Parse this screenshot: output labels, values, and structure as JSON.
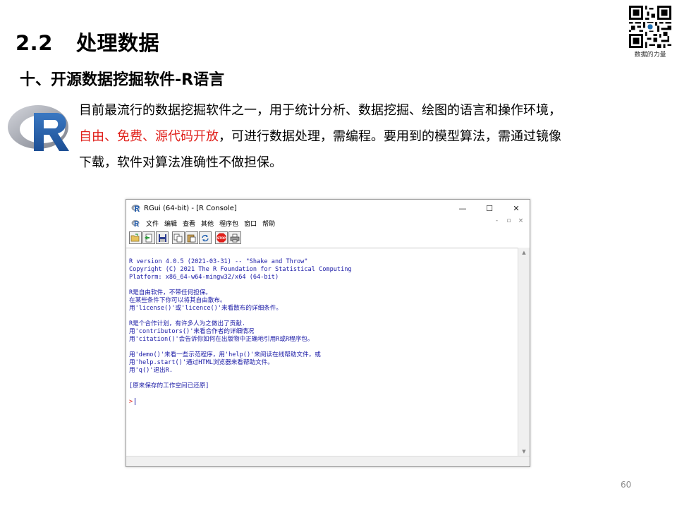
{
  "slide": {
    "section_number": "2.2",
    "section_title": "处理数据",
    "subtitle": "十、开源数据挖掘软件-R语言",
    "qr_caption": "数据的力量",
    "paragraph": {
      "line1": "目前最流行的数据挖掘软件之一，用于统计分析、数据挖掘、绘图的语言和操作环境，",
      "line2_red": "自由、免费、源代码开放",
      "line2_rest": "，可进行数据处理，需编程。要用到的模型算法，需通过镜像",
      "line3": "下载，软件对算法准确性不做担保。"
    },
    "page_number": "60",
    "colors": {
      "red_text": "#e0201b",
      "console_text": "#1a1aa6"
    }
  },
  "window": {
    "title": "RGui (64-bit) - [R Console]",
    "controls": {
      "minimize": "—",
      "maximize": "☐",
      "close": "✕"
    },
    "menu": [
      "文件",
      "编辑",
      "查看",
      "其他",
      "程序包",
      "窗口",
      "帮助"
    ],
    "mdi_controls": {
      "minimize": "-",
      "restore": "▫",
      "close": "×"
    },
    "toolbar_icons": [
      "open-script-icon",
      "load-workspace-icon",
      "save-icon",
      "copy-icon",
      "paste-icon",
      "copy-paste-icon",
      "stop-icon",
      "print-icon"
    ],
    "toolbar_stop_label": "STOP",
    "console_lines": [
      "R version 4.0.5 (2021-03-31) -- \"Shake and Throw\"",
      "Copyright (C) 2021 The R Foundation for Statistical Computing",
      "Platform: x86_64-w64-mingw32/x64 (64-bit)",
      "",
      "R是自由软件，不带任何担保。",
      "在某些条件下你可以将其自由散布。",
      "用'license()'或'licence()'来看散布的详细条件。",
      "",
      "R是个合作计划，有许多人为之做出了贡献.",
      "用'contributors()'来看合作者的详细情况",
      "用'citation()'会告诉你如何在出版物中正确地引用R或R程序包。",
      "",
      "用'demo()'来看一些示范程序，用'help()'来阅读在线帮助文件，或",
      "用'help.start()'通过HTML浏览器来看帮助文件。",
      "用'q()'退出R.",
      "",
      "[原来保存的工作空间已还原]",
      ""
    ],
    "prompt": ">"
  }
}
